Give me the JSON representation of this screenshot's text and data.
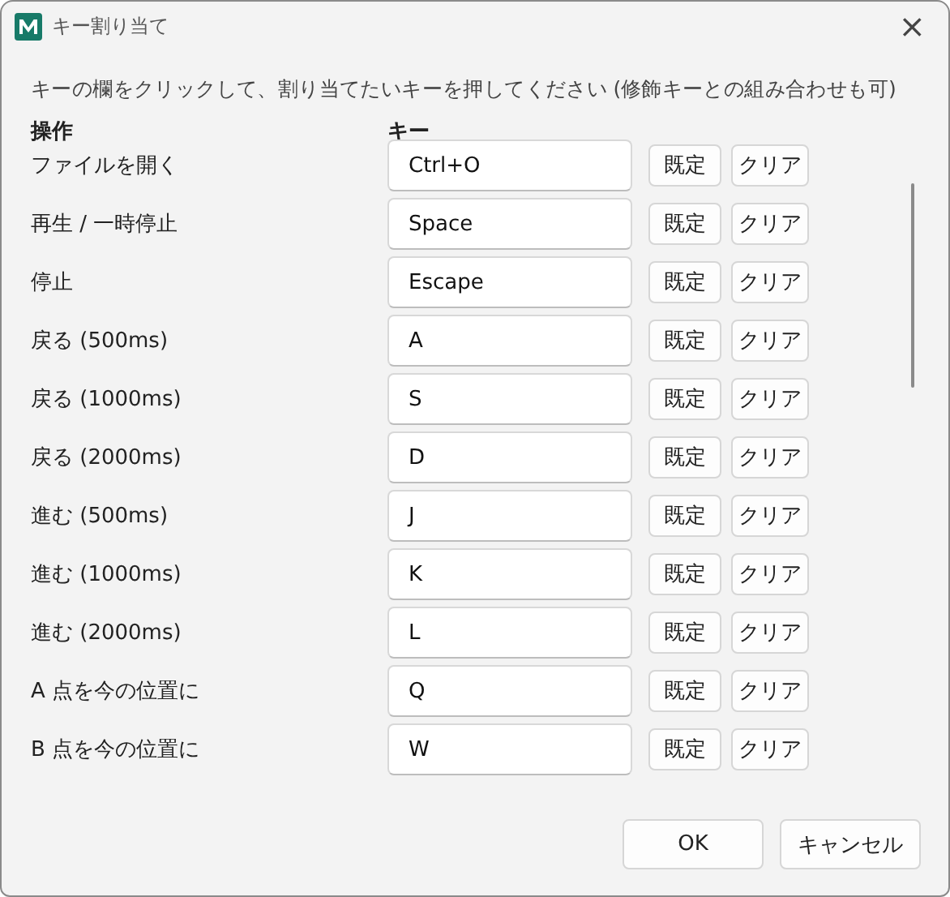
{
  "window": {
    "title": "キー割り当て",
    "close": "×"
  },
  "instruction": "キーの欄をクリックして、割り当てたいキーを押してください (修飾キーとの組み合わせも可)",
  "columns": [
    "操作",
    "キー"
  ],
  "rows": [
    {
      "action": "ファイルを開く",
      "key": "Ctrl+O",
      "default_button": "既定",
      "clear_button": "クリア"
    },
    {
      "action": "再生 / 一時停止",
      "key": "Space",
      "default_button": "既定",
      "clear_button": "クリア"
    },
    {
      "action": "停止",
      "key": "Escape",
      "default_button": "既定",
      "clear_button": "クリア"
    },
    {
      "action": "戻る (500ms)",
      "key": "A",
      "default_button": "既定",
      "clear_button": "クリア"
    },
    {
      "action": "戻る (1000ms)",
      "key": "S",
      "default_button": "既定",
      "clear_button": "クリア"
    },
    {
      "action": "戻る (2000ms)",
      "key": "D",
      "default_button": "既定",
      "clear_button": "クリア"
    },
    {
      "action": "進む (500ms)",
      "key": "J",
      "default_button": "既定",
      "clear_button": "クリア"
    },
    {
      "action": "進む (1000ms)",
      "key": "K",
      "default_button": "既定",
      "clear_button": "クリア"
    },
    {
      "action": "進む (2000ms)",
      "key": "L",
      "default_button": "既定",
      "clear_button": "クリア"
    },
    {
      "action": "A 点を今の位置に",
      "key": "Q",
      "default_button": "既定",
      "clear_button": "クリア"
    },
    {
      "action": "B 点を今の位置に",
      "key": "W",
      "default_button": "既定",
      "clear_button": "クリア"
    }
  ],
  "buttons": [
    "OK",
    "キャンセル"
  ]
}
